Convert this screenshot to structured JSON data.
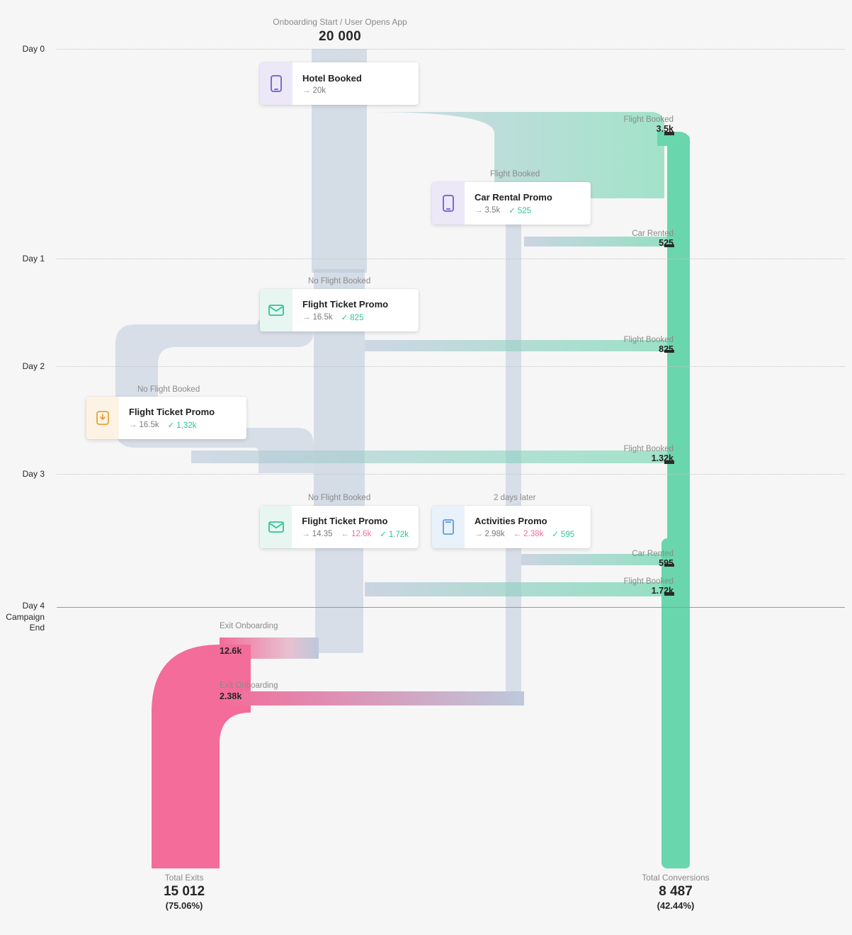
{
  "header": {
    "subtitle": "Onboarding Start / User Opens App",
    "total": "20 000"
  },
  "days": {
    "d0": "Day 0",
    "d1": "Day 1",
    "d2": "Day 2",
    "d3": "Day 3",
    "d4a": "Day 4",
    "d4b": "Campaign",
    "d4c": "End"
  },
  "cards": {
    "hotel": {
      "subtitle": "",
      "title": "Hotel Booked",
      "enter": "20k",
      "check": "",
      "back": ""
    },
    "carpromo": {
      "subtitle": "Flight Booked",
      "title": "Car Rental Promo",
      "enter": "3.5k",
      "check": "525",
      "back": ""
    },
    "ftp1": {
      "subtitle": "No Flight Booked",
      "title": "Flight Ticket Promo",
      "enter": "16.5k",
      "check": "825",
      "back": ""
    },
    "ftp2": {
      "subtitle": "No Flight Booked",
      "title": "Flight Ticket Promo",
      "enter": "16.5k",
      "check": "1,32k",
      "back": ""
    },
    "ftp3": {
      "subtitle": "No Flight Booked",
      "title": "Flight Ticket Promo",
      "enter": "14.35",
      "check": "1.72k",
      "back": "12.6k"
    },
    "act": {
      "subtitle": "2 days later",
      "title": "Activities Promo",
      "enter": "2.98k",
      "check": "595",
      "back": "2.38k"
    }
  },
  "rightMetrics": {
    "fb1": {
      "label": "Flight Booked",
      "value": "3.5k"
    },
    "cr1": {
      "label": "Car Rented",
      "value": "525"
    },
    "fb2": {
      "label": "Flight Booked",
      "value": "825"
    },
    "fb3": {
      "label": "Flight Booked",
      "value": "1.32k"
    },
    "cr2": {
      "label": "Car Rented",
      "value": "595"
    },
    "fb4": {
      "label": "Flight Booked",
      "value": "1.72k"
    }
  },
  "exits": {
    "e1": {
      "label": "Exit Onboarding",
      "value": "12.6k"
    },
    "e2": {
      "label": "Exit Onboarding",
      "value": "2.38k"
    }
  },
  "footer": {
    "exits": {
      "title": "Total Exits",
      "value": "15 012",
      "pct": "(75.06%)"
    },
    "convs": {
      "title": "Total Conversions",
      "value": "8 487",
      "pct": "(42.44%)"
    }
  },
  "colors": {
    "blueFlow": "#b8c6d9",
    "green": "#6ad6ad",
    "greenDark": "#46c497",
    "pink": "#f36c9a",
    "pinkDark": "#e9427f"
  },
  "chart_data": {
    "type": "sankey",
    "title": "Onboarding Start / User Opens App",
    "start_count": 20000,
    "nodes": [
      {
        "id": "start",
        "label": "Onboarding Start / User Opens App",
        "count": 20000,
        "day": 0
      },
      {
        "id": "hotel_booked",
        "label": "Hotel Booked",
        "count": 20000,
        "day": 0
      },
      {
        "id": "car_rental_promo",
        "label": "Car Rental Promo",
        "count": 3500,
        "conv": 525,
        "day": 0,
        "upstream_event": "Flight Booked"
      },
      {
        "id": "ftp_day1",
        "label": "Flight Ticket Promo",
        "count": 16500,
        "conv": 825,
        "day": 1,
        "upstream_event": "No Flight Booked"
      },
      {
        "id": "ftp_day2",
        "label": "Flight Ticket Promo",
        "count": 16500,
        "conv": 1320,
        "day": 2,
        "upstream_event": "No Flight Booked"
      },
      {
        "id": "ftp_day3",
        "label": "Flight Ticket Promo",
        "count": 14350,
        "conv": 1720,
        "exit": 12600,
        "day": 3,
        "upstream_event": "No Flight Booked"
      },
      {
        "id": "activities_promo",
        "label": "Activities Promo",
        "count": 2980,
        "conv": 595,
        "exit": 2380,
        "day": 3,
        "upstream_event": "2 days later"
      }
    ],
    "conversion_branches": [
      {
        "event": "Flight Booked",
        "value": 3500,
        "day": 0
      },
      {
        "event": "Car Rented",
        "value": 525,
        "day": 1
      },
      {
        "event": "Flight Booked",
        "value": 825,
        "day": 2
      },
      {
        "event": "Flight Booked",
        "value": 1320,
        "day": 3
      },
      {
        "event": "Car Rented",
        "value": 595,
        "day": 3
      },
      {
        "event": "Flight Booked",
        "value": 1720,
        "day": 4
      }
    ],
    "exit_branches": [
      {
        "event": "Exit Onboarding",
        "value": 12600,
        "day": 4
      },
      {
        "event": "Exit Onboarding",
        "value": 2380,
        "day": 4
      }
    ],
    "totals": {
      "exits": {
        "count": 15012,
        "pct": 75.06
      },
      "conversions": {
        "count": 8487,
        "pct": 42.44
      }
    },
    "days": [
      "Day 0",
      "Day 1",
      "Day 2",
      "Day 3",
      "Day 4 Campaign End"
    ]
  }
}
